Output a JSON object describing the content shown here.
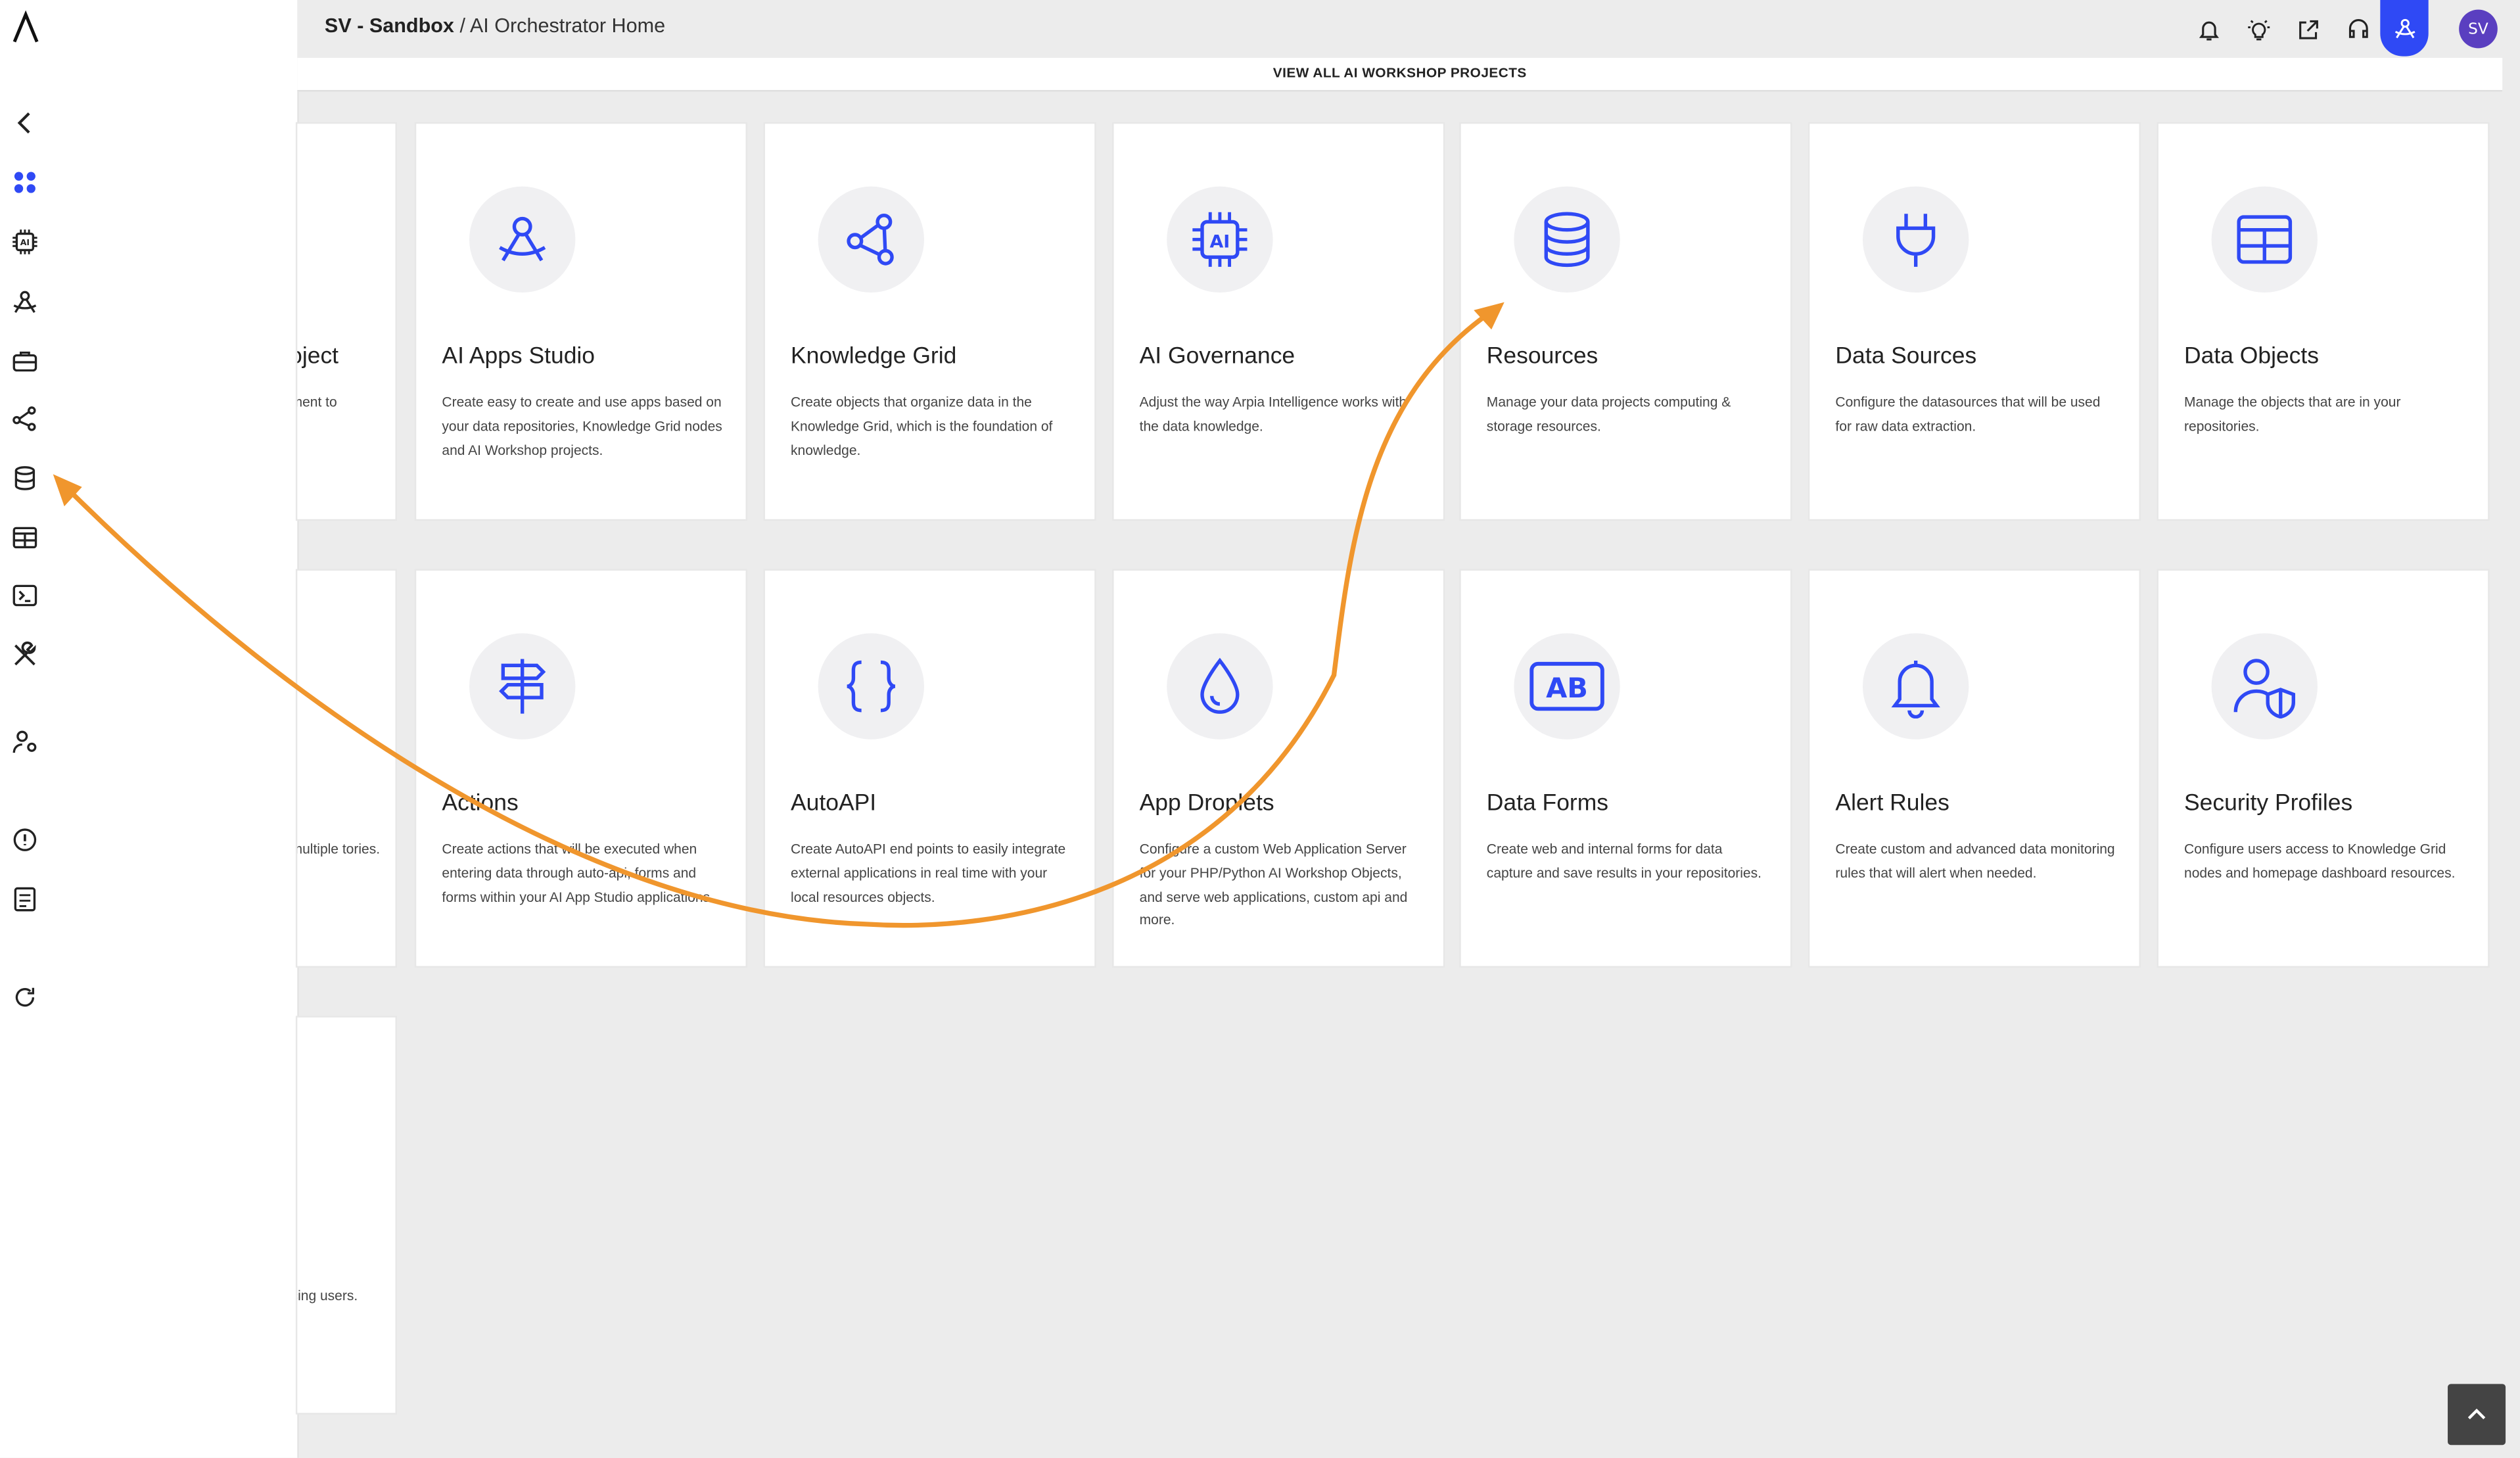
{
  "header": {
    "org": "SV - Sandbox",
    "separator": "/",
    "page": "AI Orchestrator Home",
    "avatar_initials": "SV",
    "icons": [
      "bell-icon",
      "lightbulb-icon",
      "share-icon",
      "support-headset-icon",
      "orchestrator-icon"
    ]
  },
  "projects_bar": {
    "label": "VIEW ALL AI WORKSHOP PROJECTS"
  },
  "sidebar": {
    "icons": [
      "collapse-chevron-icon",
      "dashboard-icon",
      "ai-chip-icon",
      "apps-studio-icon",
      "toolbox-icon",
      "knowledge-grid-icon",
      "database-icon",
      "table-icon",
      "terminal-icon",
      "tools-icon",
      "user-settings-icon",
      "help-icon",
      "docs-icon",
      "refresh-icon"
    ]
  },
  "cards_row1": [
    {
      "title": "oject",
      "desc": "ment to"
    },
    {
      "title": "AI Apps Studio",
      "desc": "Create easy to create and use apps based on your data repositories, Knowledge Grid nodes and AI Workshop projects."
    },
    {
      "title": "Knowledge Grid",
      "desc": "Create objects that organize data in the Knowledge Grid, which is the foundation of knowledge."
    },
    {
      "title": "AI Governance",
      "desc": "Adjust the way Arpia Intelligence works with the data knowledge."
    },
    {
      "title": "Resources",
      "desc": "Manage your data projects computing & storage resources."
    },
    {
      "title": "Data Sources",
      "desc": "Configure the datasources that will be used for raw data extraction."
    },
    {
      "title": "Data Objects",
      "desc": "Manage the objects that are in your repositories."
    }
  ],
  "cards_row2": [
    {
      "title": "",
      "desc": "multiple tories."
    },
    {
      "title": "Actions",
      "desc": "Create actions that will be executed when entering data through auto-api, forms and forms within your AI App Studio applications."
    },
    {
      "title": "AutoAPI",
      "desc": "Create AutoAPI end points to easily integrate external applications in real time with your local resources objects."
    },
    {
      "title": "App Droplets",
      "desc": "Configure a custom Web Application Server for your PHP/Python AI Workshop Objects, and serve web applications, custom api and more."
    },
    {
      "title": "Data Forms",
      "desc": "Create web and internal forms for data capture and save results in your repositories."
    },
    {
      "title": "Alert Rules",
      "desc": "Create custom and advanced data monitoring rules that will alert when needed."
    },
    {
      "title": "Security Profiles",
      "desc": "Configure users access to Knowledge Grid nodes and homepage dashboard resources."
    }
  ],
  "cards_row3": [
    {
      "title": "",
      "desc": "cing users."
    }
  ],
  "accent_color": "#2f49f5",
  "annotation_color": "#f0962d"
}
